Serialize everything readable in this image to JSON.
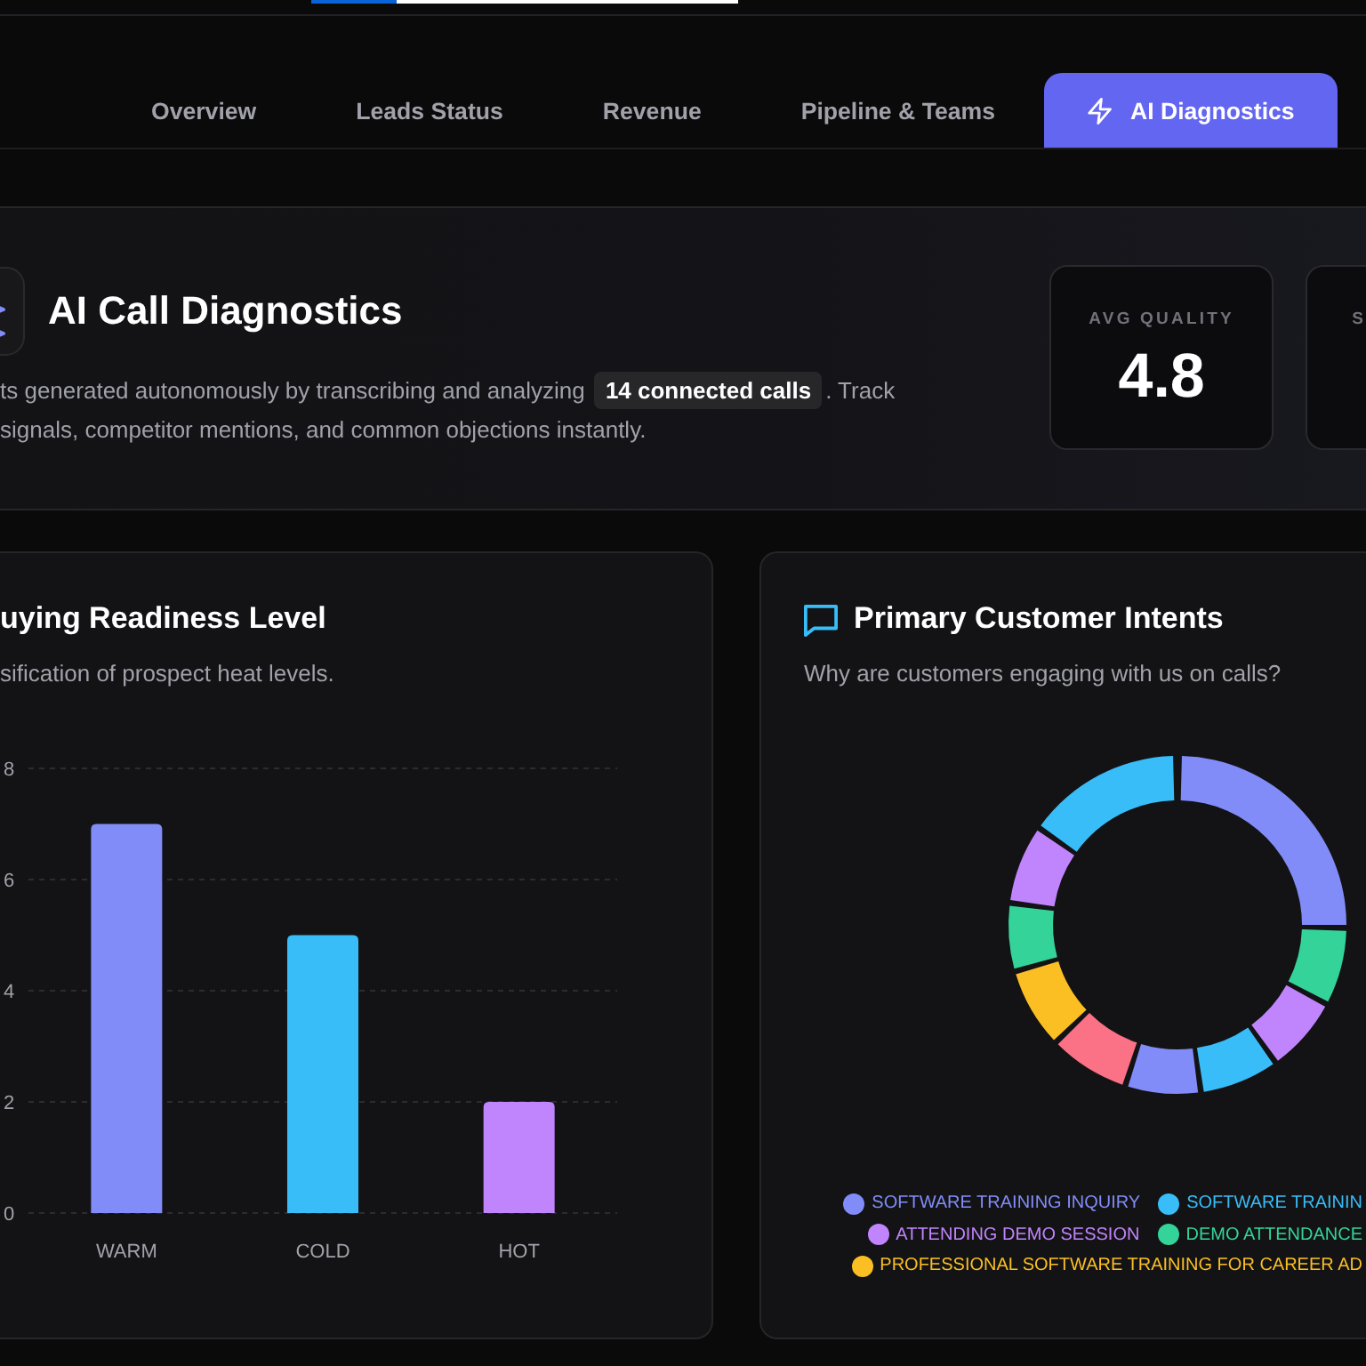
{
  "progress": {
    "level": 0.2
  },
  "tabs": [
    {
      "label": "Overview",
      "selected": false,
      "icon": false
    },
    {
      "label": "Leads Status",
      "selected": false,
      "icon": false
    },
    {
      "label": "Revenue",
      "selected": false,
      "icon": false
    },
    {
      "label": "Pipeline & Teams",
      "selected": false,
      "icon": false
    },
    {
      "label": "AI Diagnostics",
      "selected": true,
      "icon": true
    }
  ],
  "hero": {
    "title": "AI Call Diagnostics",
    "description": "ts generated autonomously by transcribing and analyzing **14 connected calls**. Track\nsignals, competitor mentions, and common objections instantly.",
    "stats": [
      {
        "label": "AVG QUALITY",
        "value": "4.8"
      },
      {
        "label": "S"
      }
    ]
  },
  "readiness_card": {
    "title": "uying Readiness Level",
    "subtitle": "sification of prospect heat levels.",
    "chart_data": {
      "type": "bar",
      "categories": [
        "WARM",
        "COLD",
        "HOT"
      ],
      "values": [
        7,
        5,
        2
      ],
      "ylim": [
        0,
        8
      ],
      "yticks": [
        0,
        2,
        4,
        6,
        8
      ],
      "grid": true
    }
  },
  "intents_card": {
    "title": "Primary Customer Intents",
    "subtitle": "Why are customers engaging with us on calls?",
    "legend": [
      {
        "label": "SOFTWARE TRAINING INQUIRY",
        "color": "#818cf8"
      },
      {
        "label": "SOFTWARE TRAININ",
        "color": "#38bdf8"
      },
      {
        "label": "ATTENDING DEMO SESSION",
        "color": "#c084fc"
      },
      {
        "label": "DEMO ATTENDANCE",
        "color": "#34d399"
      },
      {
        "label": "PROFESSIONAL SOFTWARE TRAINING FOR CAREER AD",
        "color": "#fbbf24"
      }
    ]
  }
}
